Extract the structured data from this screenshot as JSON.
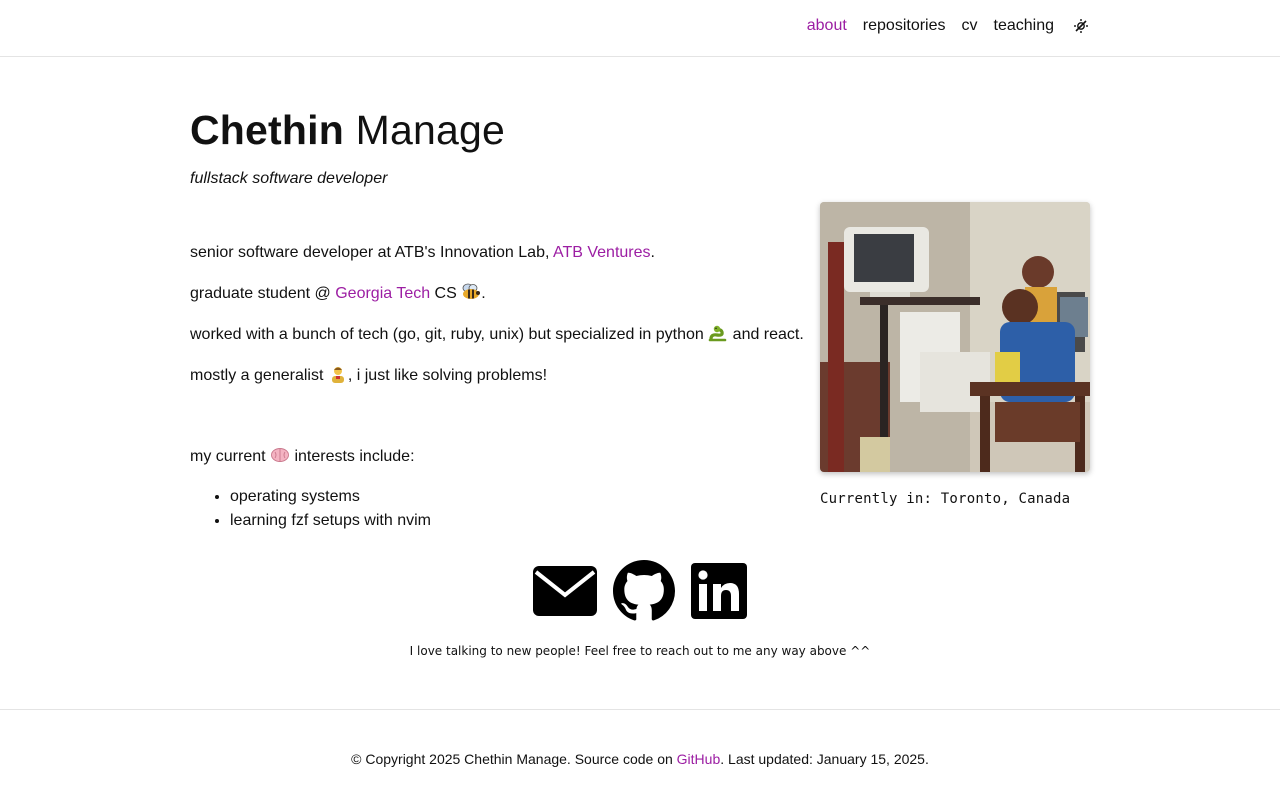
{
  "nav": {
    "items": [
      {
        "label": "about",
        "active": true
      },
      {
        "label": "repositories",
        "active": false
      },
      {
        "label": "cv",
        "active": false
      },
      {
        "label": "teaching",
        "active": false
      }
    ],
    "theme_toggle_icon": "theme-toggle-icon"
  },
  "header": {
    "first_name": "Chethin",
    "last_name": "Manage",
    "subtitle": "fullstack software developer"
  },
  "profile": {
    "photo_alt_icon": "profile-photo",
    "location_text": "Currently in: Toronto, Canada"
  },
  "bio": {
    "line1_prefix": "senior software developer at ATB's Innovation Lab, ",
    "line1_link": "ATB Ventures",
    "line1_suffix": ".",
    "line2_prefix": "graduate student @ ",
    "line2_link": "Georgia Tech",
    "line2_middle": " CS ",
    "line2_suffix": ".",
    "line3_prefix": "worked with a bunch of tech (go, git, ruby, unix) but specialized in python ",
    "line3_suffix": " and react.",
    "line4_prefix": "mostly a generalist ",
    "line4_suffix": ", i just like solving problems!",
    "interests_prefix": "my current ",
    "interests_suffix": " interests include:",
    "interests": [
      "operating systems",
      "learning fzf setups with nvim"
    ]
  },
  "social": {
    "icons": [
      "email-icon",
      "github-icon",
      "linkedin-icon"
    ],
    "note": "I love talking to new people! Feel free to reach out to me any way above ^^"
  },
  "footer": {
    "prefix": "© Copyright 2025 Chethin Manage. Source code on ",
    "link": "GitHub",
    "suffix": ". Last updated: January 15, 2025."
  },
  "colors": {
    "accent": "#9c1ea3",
    "text": "#111111",
    "border": "#e4e4e4"
  }
}
